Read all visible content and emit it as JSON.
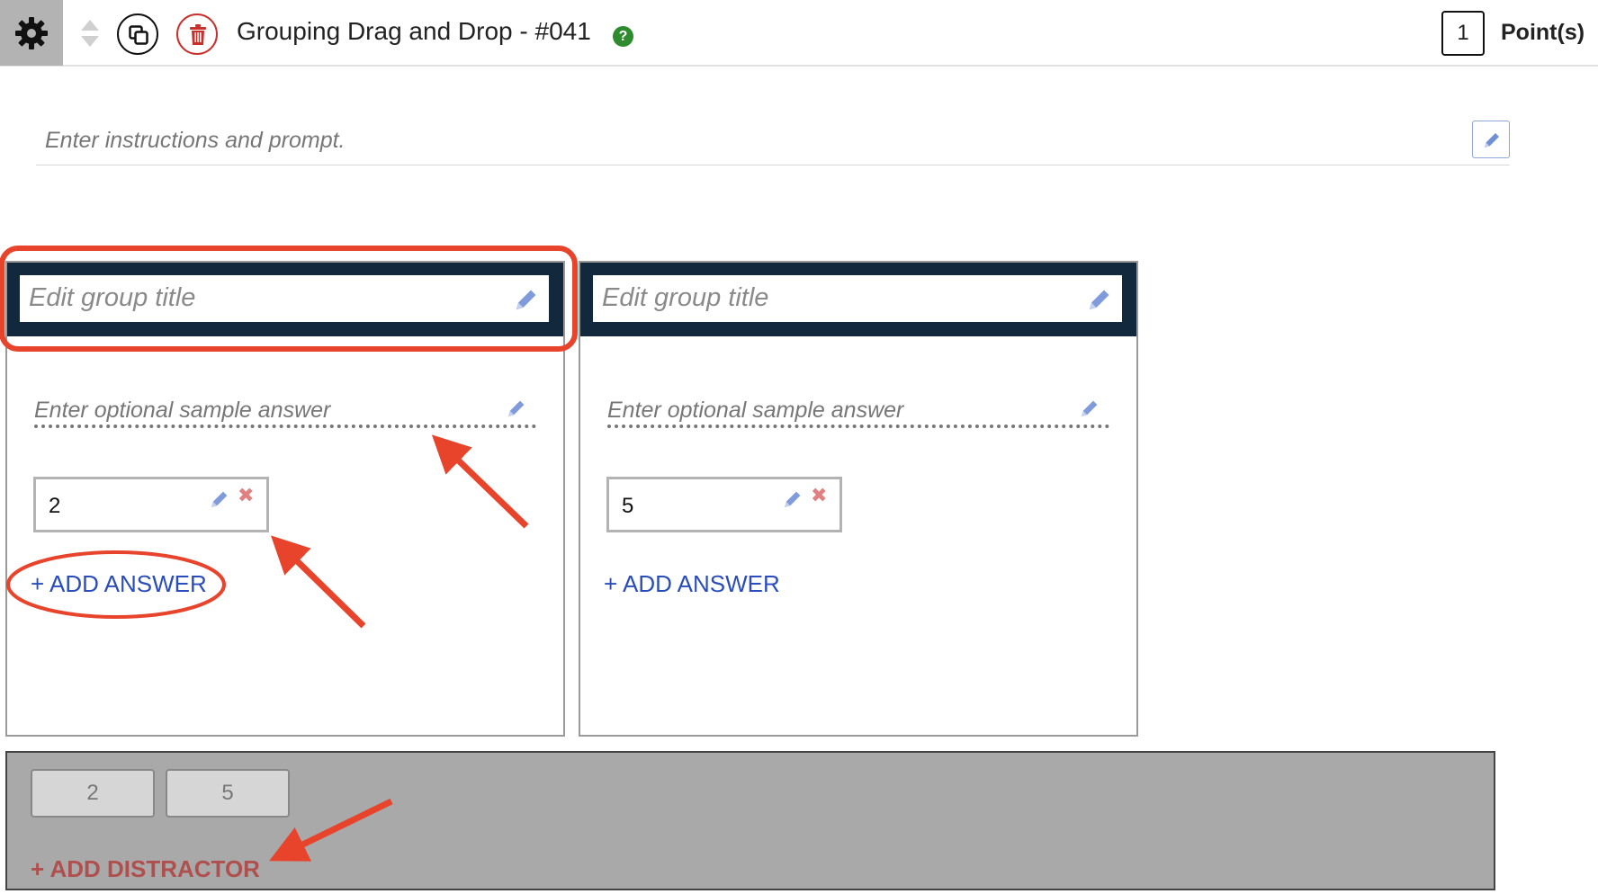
{
  "toolbar": {
    "title": "Grouping Drag and Drop - #041",
    "help_symbol": "?",
    "points_value": "1",
    "points_label": "Point(s)",
    "icons": [
      "gear-icon",
      "move-updown-icon",
      "copy-icon",
      "trash-icon",
      "help-icon"
    ]
  },
  "instructions": {
    "placeholder": "Enter instructions and prompt.",
    "edit_icon": "pencil-icon"
  },
  "groups": [
    {
      "title_placeholder": "Edit group title",
      "sample_placeholder": "Enter optional sample answer",
      "answers": [
        "2"
      ],
      "add_answer_label": "+ ADD ANSWER"
    },
    {
      "title_placeholder": "Edit group title",
      "sample_placeholder": "Enter optional sample answer",
      "answers": [
        "5"
      ],
      "add_answer_label": "+ ADD ANSWER"
    }
  ],
  "answer_controls": {
    "remove_symbol": "✖"
  },
  "distractors": {
    "chips": [
      "2",
      "5"
    ],
    "add_label": "+ ADD DISTRACTOR"
  },
  "colors": {
    "header_bg": "#12283c",
    "link_blue": "#2a4dbb",
    "distractor_bg": "#a9a9a9",
    "distractor_link": "#b0504e",
    "annotation_red": "#e8432b",
    "help_green": "#2e8b2e",
    "delete_red": "#c9302c"
  }
}
